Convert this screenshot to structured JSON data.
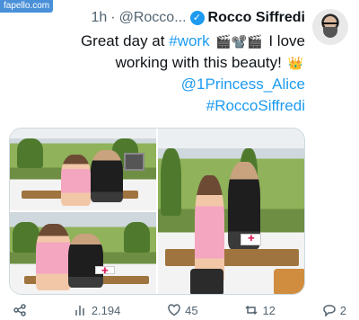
{
  "watermark": "fapello.com",
  "user": {
    "name": "Rocco Siffredi",
    "verified_mark": "✓",
    "handle": "@Rocco...",
    "separator": "·",
    "time": "1h"
  },
  "tweet": {
    "line1_text": "Great day at",
    "line1_hashtag": "#work",
    "line1_emoji": "🎬📽️🎬",
    "line1_tail": "I love",
    "line2_text": "working with this beauty!",
    "line2_emoji": "👑",
    "mention1": "@1Princess_Alice",
    "mention2": "#RoccoSiffredi"
  },
  "media": {
    "photos": [
      "photo-1",
      "photo-2",
      "photo-3"
    ]
  },
  "actions": {
    "views": "2.194",
    "likes": "45",
    "retweets": "12",
    "replies": "2",
    "icons": [
      "share-icon",
      "views-icon",
      "like-icon",
      "retweet-icon",
      "reply-icon"
    ]
  }
}
